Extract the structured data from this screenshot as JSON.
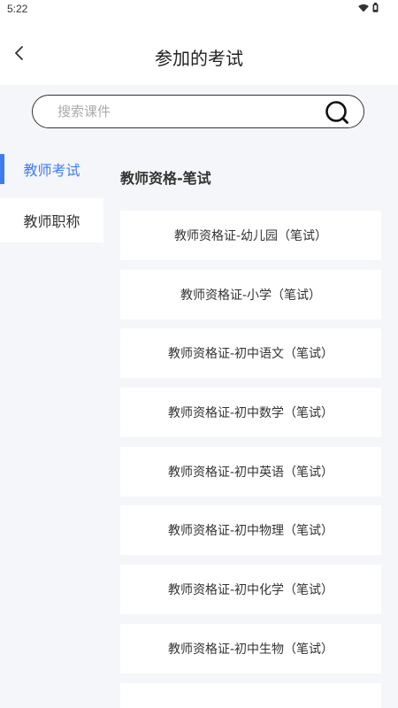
{
  "status_bar": {
    "time": "5:22"
  },
  "header": {
    "title": "参加的考试",
    "back_icon": "chevron-left-icon"
  },
  "search": {
    "placeholder": "搜索课件",
    "value": "",
    "icon": "search-icon"
  },
  "sidebar": {
    "items": [
      {
        "label": "教师考试",
        "active": true
      },
      {
        "label": "教师职称",
        "active": false
      }
    ]
  },
  "main": {
    "section_title": "教师资格-笔试",
    "items": [
      {
        "label": "教师资格证-幼儿园（笔试）"
      },
      {
        "label": "教师资格证-小学（笔试）"
      },
      {
        "label": "教师资格证-初中语文（笔试）"
      },
      {
        "label": "教师资格证-初中数学（笔试）"
      },
      {
        "label": "教师资格证-初中英语（笔试）"
      },
      {
        "label": "教师资格证-初中物理（笔试）"
      },
      {
        "label": "教师资格证-初中化学（笔试）"
      },
      {
        "label": "教师资格证-初中生物（笔试）"
      },
      {
        "label": ""
      }
    ]
  },
  "colors": {
    "accent": "#3d7bf7",
    "background": "#f5f6f9"
  }
}
